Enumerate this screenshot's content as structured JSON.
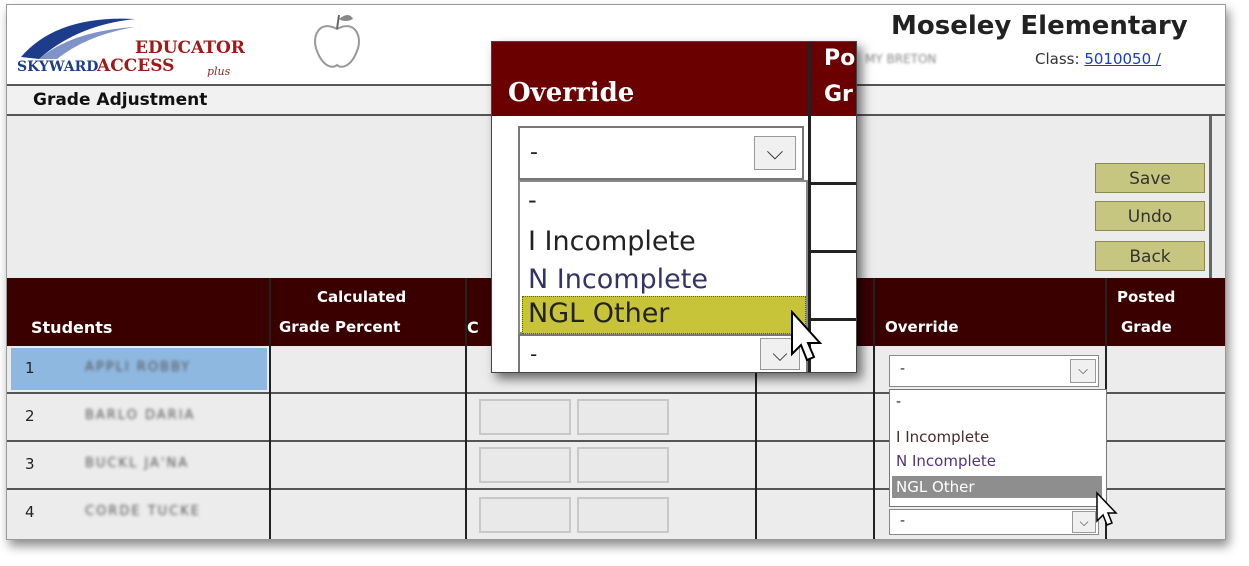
{
  "app": {
    "logo_text_top": "EDUCATOR",
    "logo_text_bottom": "ACCESS",
    "logo_plus": "plus",
    "logo_brand": "SKYWARD"
  },
  "header": {
    "school": "Moseley Elementary",
    "teacher": "MY BRETON",
    "class_label": "Class:",
    "class_link": "5010050 /"
  },
  "page_title": "Grade Adjustment",
  "buttons": {
    "save": "Save",
    "undo": "Undo",
    "back": "Back"
  },
  "table": {
    "headers": {
      "students": "Students",
      "calc_line1": "Calculated",
      "calc_line2": "Grade Percent",
      "col_c": "C",
      "override": "Override",
      "posted_line1": "Posted",
      "posted_line2": "Grade"
    },
    "rows": [
      {
        "num": "1",
        "name": "APPLI ROBBY",
        "selected": true
      },
      {
        "num": "2",
        "name": "BARLO DARIA",
        "selected": false
      },
      {
        "num": "3",
        "name": "BUCKL JA'NA",
        "selected": false
      },
      {
        "num": "4",
        "name": "CORDE TUCKE",
        "selected": false
      }
    ]
  },
  "override_dropdown": {
    "selected": "-",
    "options": [
      "-",
      "I Incomplete",
      "N Incomplete",
      "NGL Other"
    ],
    "highlighted": "NGL Other",
    "row4_value": "-"
  },
  "zoom_popup": {
    "header": "Override",
    "side_header_line1": "Po",
    "side_header_line2": "Gr",
    "selected": "-",
    "options": [
      "-",
      "I Incomplete",
      "N Incomplete",
      "NGL Other"
    ],
    "highlighted": "NGL Other",
    "lower_value": "-"
  },
  "colors": {
    "header_bg": "#3a0000",
    "button_bg": "#c7c680",
    "highlight": "#c8c43a",
    "row_selected": "#8fb8e0",
    "link": "#1a3cbf"
  },
  "icons": [
    "chevron-down-icon",
    "mouse-pointer-icon",
    "apple-icon",
    "swoosh-logo-icon"
  ]
}
